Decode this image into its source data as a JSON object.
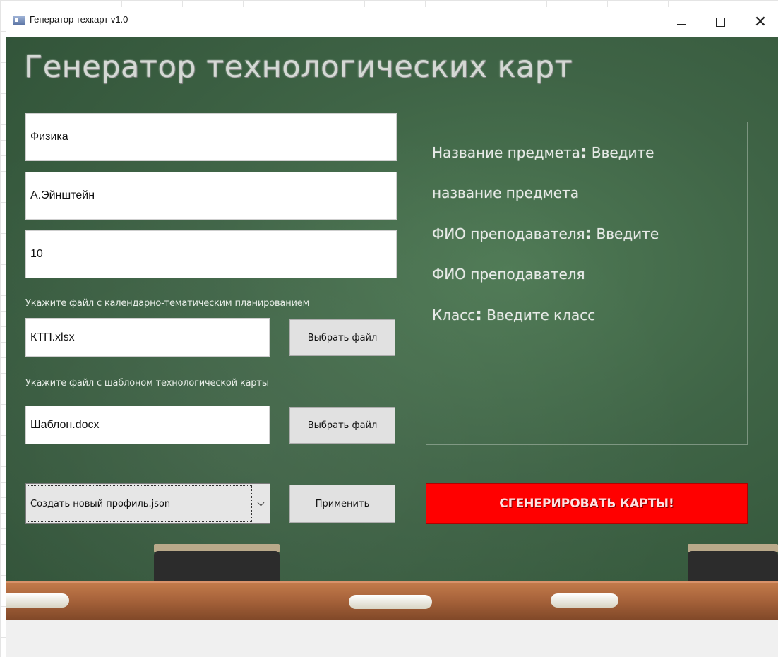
{
  "window": {
    "title": "Генератор техкарт v1.0",
    "controls": {
      "minimize": "minimize",
      "maximize": "maximize",
      "close": "✕"
    }
  },
  "main": {
    "heading": "Генератор технологических карт",
    "subject_value": "Физика",
    "teacher_value": "А.Эйнштейн",
    "class_value": "10",
    "ktp_hint": "Укажите файл с календарно-тематическим планированием",
    "ktp_value": "КТП.xlsx",
    "ktp_button": "Выбрать файл",
    "template_hint": "Укажите файл с шаблоном технологической карты",
    "template_value": "Шаблон.docx",
    "template_button": "Выбрать файл",
    "profile_selected": "Создать новый профиль.json",
    "apply_button": "Применить",
    "generate_button": "СГЕНЕРИРОВАТЬ КАРТЫ!"
  },
  "info": {
    "subject_label": "Название предмета",
    "subject_text": " Введите",
    "subject_text2": "название предмета",
    "teacher_label": "ФИО преподавателя",
    "teacher_text": " Введите",
    "teacher_text2": "ФИО преподавателя",
    "class_label": "Класс",
    "class_text": " Введите класс",
    "colon": ":"
  },
  "colors": {
    "board": "#3f6446",
    "generate": "#ff0000",
    "ledge": "#a6623a"
  }
}
